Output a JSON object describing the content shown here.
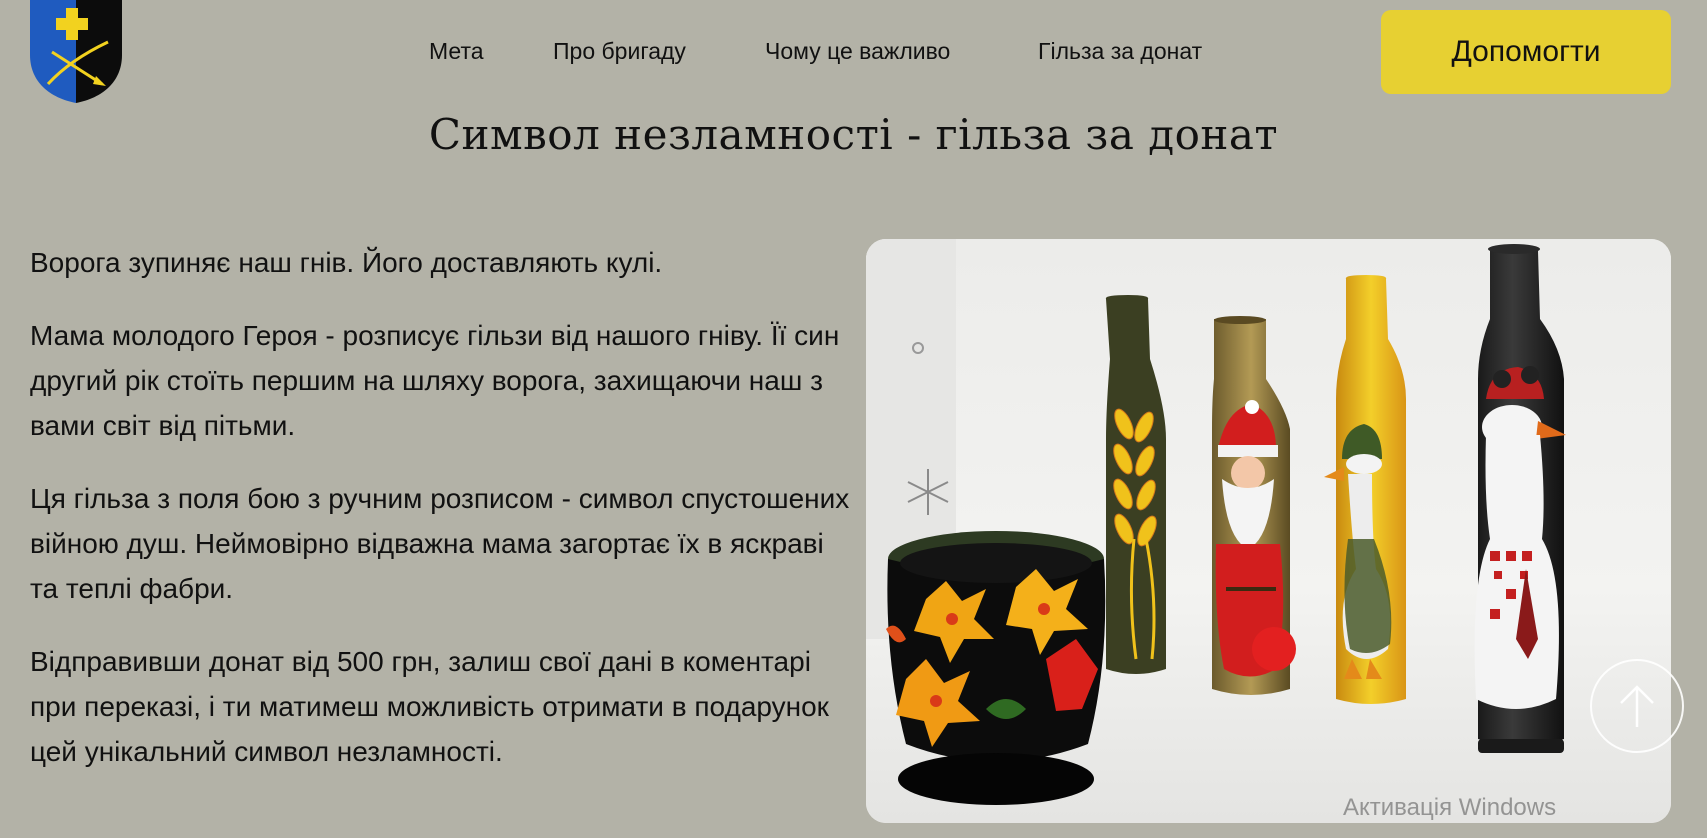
{
  "nav": {
    "items": [
      {
        "label": "Мета"
      },
      {
        "label": "Про бригаду"
      },
      {
        "label": "Чому це важливо"
      },
      {
        "label": "Гільза за донат"
      }
    ],
    "cta_label": "Допомогти"
  },
  "logo": {
    "icon": "brigade-emblem",
    "colors": {
      "left": "#1f5bbf",
      "right": "#0c0c0c",
      "accent": "#f2d21f"
    }
  },
  "page": {
    "title": "Символ незламності - гільза за донат"
  },
  "content": {
    "paragraphs": [
      "Ворога зупиняє наш гнів. Його доставляють кулі.",
      "Мама молодого Героя - розписує гільзи від нашого гніву. Її син другий рік стоїть першим на шляху ворога, захищаючи наш з вами світ від пітьми.",
      "Ця гільза з поля бою з ручним розписом - символ спустошених війною душ. Неймовірно відважна мама загортає їх в яскраві та теплі фабри.",
      "Відправивши донат від 500 грн, залиш свої дані в коментарі при переказі, і ти матимеш можливість отримати в подарунок цей унікальний символ незламності."
    ]
  },
  "photo": {
    "icon": "painted-shell-casings-photo"
  },
  "scroll_top": {
    "icon": "arrow-up-icon"
  },
  "system": {
    "watermark": "Активація Windows"
  },
  "colors": {
    "background": "#b3b2a7",
    "button": "#e7d032",
    "text": "#111111"
  }
}
